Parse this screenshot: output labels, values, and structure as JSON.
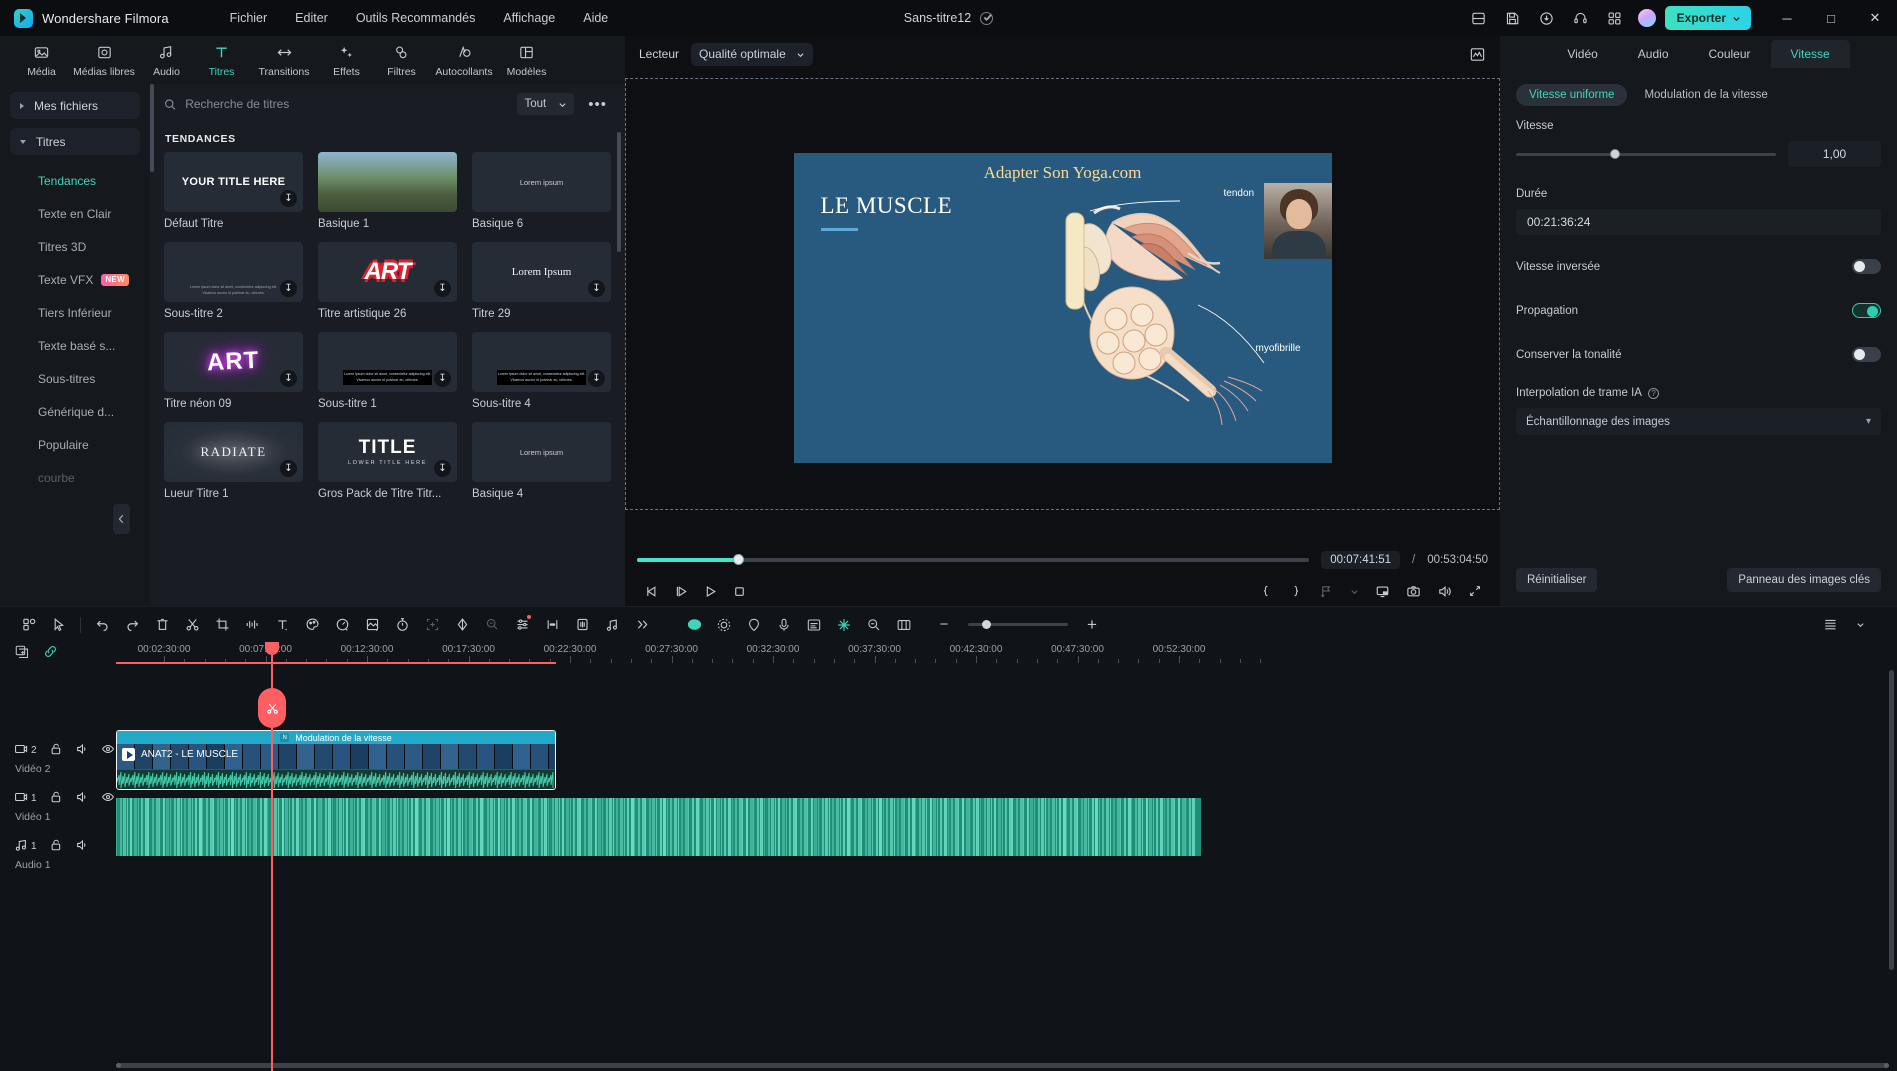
{
  "app": {
    "brand": "Wondershare Filmora",
    "document_title": "Sans-titre12",
    "menus": [
      "Fichier",
      "Editer",
      "Outils Recommandés",
      "Affichage",
      "Aide"
    ],
    "export_label": "Exporter",
    "window_buttons": {
      "minimize": "─",
      "maximize": "□",
      "close": "✕"
    },
    "title_icons": [
      "save-as-icon",
      "save-icon",
      "upload-icon",
      "support-icon",
      "apps-icon"
    ]
  },
  "tooltabs": [
    {
      "label": "Média",
      "icon": "media-icon",
      "active": false
    },
    {
      "label": "Médias libres",
      "icon": "stock-media-icon",
      "active": false
    },
    {
      "label": "Audio",
      "icon": "audio-note-icon",
      "active": false
    },
    {
      "label": "Titres",
      "icon": "titles-T-icon",
      "active": true
    },
    {
      "label": "Transitions",
      "icon": "transitions-icon",
      "active": false
    },
    {
      "label": "Effets",
      "icon": "effects-sparkle-icon",
      "active": false
    },
    {
      "label": "Filtres",
      "icon": "filters-circles-icon",
      "active": false
    },
    {
      "label": "Autocollants",
      "icon": "stickers-icon",
      "active": false
    },
    {
      "label": "Modèles",
      "icon": "templates-icon",
      "active": false
    }
  ],
  "categories": {
    "roots": [
      {
        "label": "Mes fichiers",
        "expanded": false
      },
      {
        "label": "Titres",
        "expanded": true
      }
    ],
    "items": [
      {
        "label": "Tendances",
        "active": true,
        "badge": ""
      },
      {
        "label": "Texte en Clair",
        "active": false,
        "badge": ""
      },
      {
        "label": "Titres 3D",
        "active": false,
        "badge": ""
      },
      {
        "label": "Texte VFX",
        "active": false,
        "badge": "NEW"
      },
      {
        "label": "Tiers Inférieur",
        "active": false,
        "badge": ""
      },
      {
        "label": "Texte basé s...",
        "active": false,
        "badge": ""
      },
      {
        "label": "Sous-titres",
        "active": false,
        "badge": ""
      },
      {
        "label": "Générique d...",
        "active": false,
        "badge": ""
      },
      {
        "label": "Populaire",
        "active": false,
        "badge": ""
      },
      {
        "label": "courbe",
        "active": false,
        "badge": ""
      }
    ]
  },
  "search": {
    "placeholder": "Recherche de titres",
    "value": "",
    "filter_label": "Tout",
    "more_label": "•••"
  },
  "library": {
    "section_title": "TENDANCES",
    "items": [
      {
        "caption": "Défaut Titre",
        "style": "default",
        "text": "YOUR TITLE HERE",
        "download": true
      },
      {
        "caption": "Basique 1",
        "style": "photo",
        "text": "",
        "download": false
      },
      {
        "caption": "Basique 6",
        "style": "lorem-small",
        "text": "Lorem ipsum",
        "download": false
      },
      {
        "caption": "Sous-titre 2",
        "style": "subplain",
        "text": "Lorem ipsum dolor sit amet, consectetur adipiscing elit. Vivamus auctor id pulvinar eu, ultricies.",
        "download": true
      },
      {
        "caption": "Titre artistique 26",
        "style": "art",
        "text": "ART",
        "download": true
      },
      {
        "caption": "Titre 29",
        "style": "lorem-serif",
        "text": "Lorem Ipsum",
        "download": true
      },
      {
        "caption": "Titre néon 09",
        "style": "neon",
        "text": "ART",
        "download": true
      },
      {
        "caption": "Sous-titre 1",
        "style": "subblock",
        "text": "Lorem ipsum dolor sit amet, consectetur adipiscing elit. Vivamus auctor id pulvinar eu, ultricies.",
        "download": true
      },
      {
        "caption": "Sous-titre 4",
        "style": "subblock",
        "text": "Lorem ipsum dolor sit amet, consectetur adipiscing elit. Vivamus auctor id pulvinar eu, ultricies.",
        "download": true
      },
      {
        "caption": "Lueur Titre 1",
        "style": "radiate",
        "text": "RADIATE",
        "download": true
      },
      {
        "caption": "Gros Pack de Titre Titr...",
        "style": "title-lower",
        "text": "TITLE",
        "subtext": "LOWER TITLE HERE",
        "download": true
      },
      {
        "caption": "Basique 4",
        "style": "lorem-small",
        "text": "Lorem ipsum",
        "download": false
      }
    ]
  },
  "preview": {
    "player_label": "Lecteur",
    "quality_label": "Qualité optimale",
    "video": {
      "watermark": "Adapter Son Yoga.com",
      "title": "LE MUSCLE",
      "annotations": [
        "tendon",
        "myofibrille"
      ]
    },
    "current_time": "00:07:41:51",
    "separator": "/",
    "total_time": "00:53:04:50",
    "progress_percent": 15,
    "controls": [
      "prev-frame-icon",
      "next-frame-icon",
      "play-icon",
      "stop-icon"
    ],
    "right_controls": [
      "mark-in-icon",
      "mark-out-icon",
      "add-marker-icon",
      "chevron-down-icon",
      "pip-icon",
      "snapshot-icon",
      "volume-icon",
      "fullscreen-icon"
    ]
  },
  "properties": {
    "tabs": [
      {
        "label": "Vidéo",
        "active": false
      },
      {
        "label": "Audio",
        "active": false
      },
      {
        "label": "Couleur",
        "active": false
      },
      {
        "label": "Vitesse",
        "active": true
      }
    ],
    "segments": [
      {
        "label": "Vitesse uniforme",
        "active": true
      },
      {
        "label": "Modulation de la vitesse",
        "active": false
      }
    ],
    "speed": {
      "label": "Vitesse",
      "value": "1,00",
      "slider_percent": 36
    },
    "duration": {
      "label": "Durée",
      "value": "00:21:36:24"
    },
    "toggles": [
      {
        "label": "Vitesse inversée",
        "on": false
      },
      {
        "label": "Propagation",
        "on": true
      },
      {
        "label": "Conserver la tonalité",
        "on": false
      }
    ],
    "ai_frame": {
      "label": "Interpolation de trame IA",
      "help": "?",
      "selected": "Échantillonnage des images"
    },
    "footer": {
      "reset_label": "Réinitialiser",
      "keyframe_label": "Panneau des images clés"
    }
  },
  "timeline": {
    "toolbar_icons": [
      "grid-view-icon",
      "select-tool-icon",
      "undo-icon",
      "redo-icon",
      "delete-icon",
      "split-icon",
      "crop-icon",
      "audio-detach-icon",
      "text-icon",
      "color-match-icon",
      "speed-icon",
      "mask-icon",
      "stopwatch-icon",
      "auto-reframe-icon",
      "keyframe-icon",
      "audio-ducking-icon",
      "adjust-icon",
      "silence-detect-icon",
      "audio-stretch-icon",
      "render-icon",
      "more-icon"
    ],
    "right_icons": [
      "markers-icon",
      "chevron-down-icon"
    ],
    "zoom_out": "−",
    "zoom_in": "+",
    "ruler_ticks": [
      "00:02:30:00",
      "00:07:30:00",
      "00:12:30:00",
      "00:17:30:00",
      "00:22:30:00",
      "00:27:30:00",
      "00:32:30:00",
      "00:37:30:00",
      "00:42:30:00",
      "00:47:30:00",
      "00:52:30:00"
    ],
    "tracks": [
      {
        "name": "Vidéo 2",
        "number": "2",
        "type": "video",
        "icons": [
          "track-video-icon",
          "lock-icon",
          "mute-icon",
          "eye-icon"
        ]
      },
      {
        "name": "Vidéo 1",
        "number": "1",
        "type": "video",
        "icons": [
          "track-video-icon",
          "lock-icon",
          "mute-icon",
          "eye-icon"
        ]
      },
      {
        "name": "Audio 1",
        "number": "1",
        "type": "audio",
        "icons": [
          "track-audio-icon",
          "lock-icon",
          "mute-icon"
        ]
      }
    ],
    "clip": {
      "banner": "Modulation de la vitesse",
      "label": "ANAT2 - LE MUSCLE"
    },
    "header_icons": [
      "add-track-icon",
      "link-icon"
    ]
  },
  "colors": {
    "accent": "#3ed6bb",
    "export": "#3ee0c0",
    "playhead": "#ff5f63",
    "clip_banner": "#23a8c8",
    "audio_track": "#1f8f79"
  }
}
